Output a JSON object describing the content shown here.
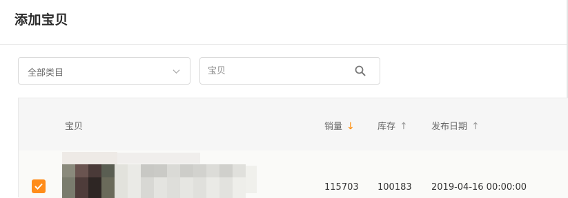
{
  "header": {
    "title": "添加宝贝"
  },
  "filters": {
    "category_value": "全部类目",
    "search_placeholder": "宝贝"
  },
  "table": {
    "columns": [
      {
        "label": "宝贝"
      },
      {
        "label": "销量",
        "sort": "↓",
        "active": true
      },
      {
        "label": "库存",
        "sort": "↑",
        "active": false
      },
      {
        "label": "发布日期",
        "sort": "↑",
        "active": false
      }
    ],
    "rows": [
      {
        "checked": true,
        "sales": "115703",
        "stock": "100183",
        "date": "2019-04-16 00:00:00"
      }
    ]
  },
  "colors": {
    "accent": "#ff8c1a",
    "sort_active": "#ff8a00"
  }
}
